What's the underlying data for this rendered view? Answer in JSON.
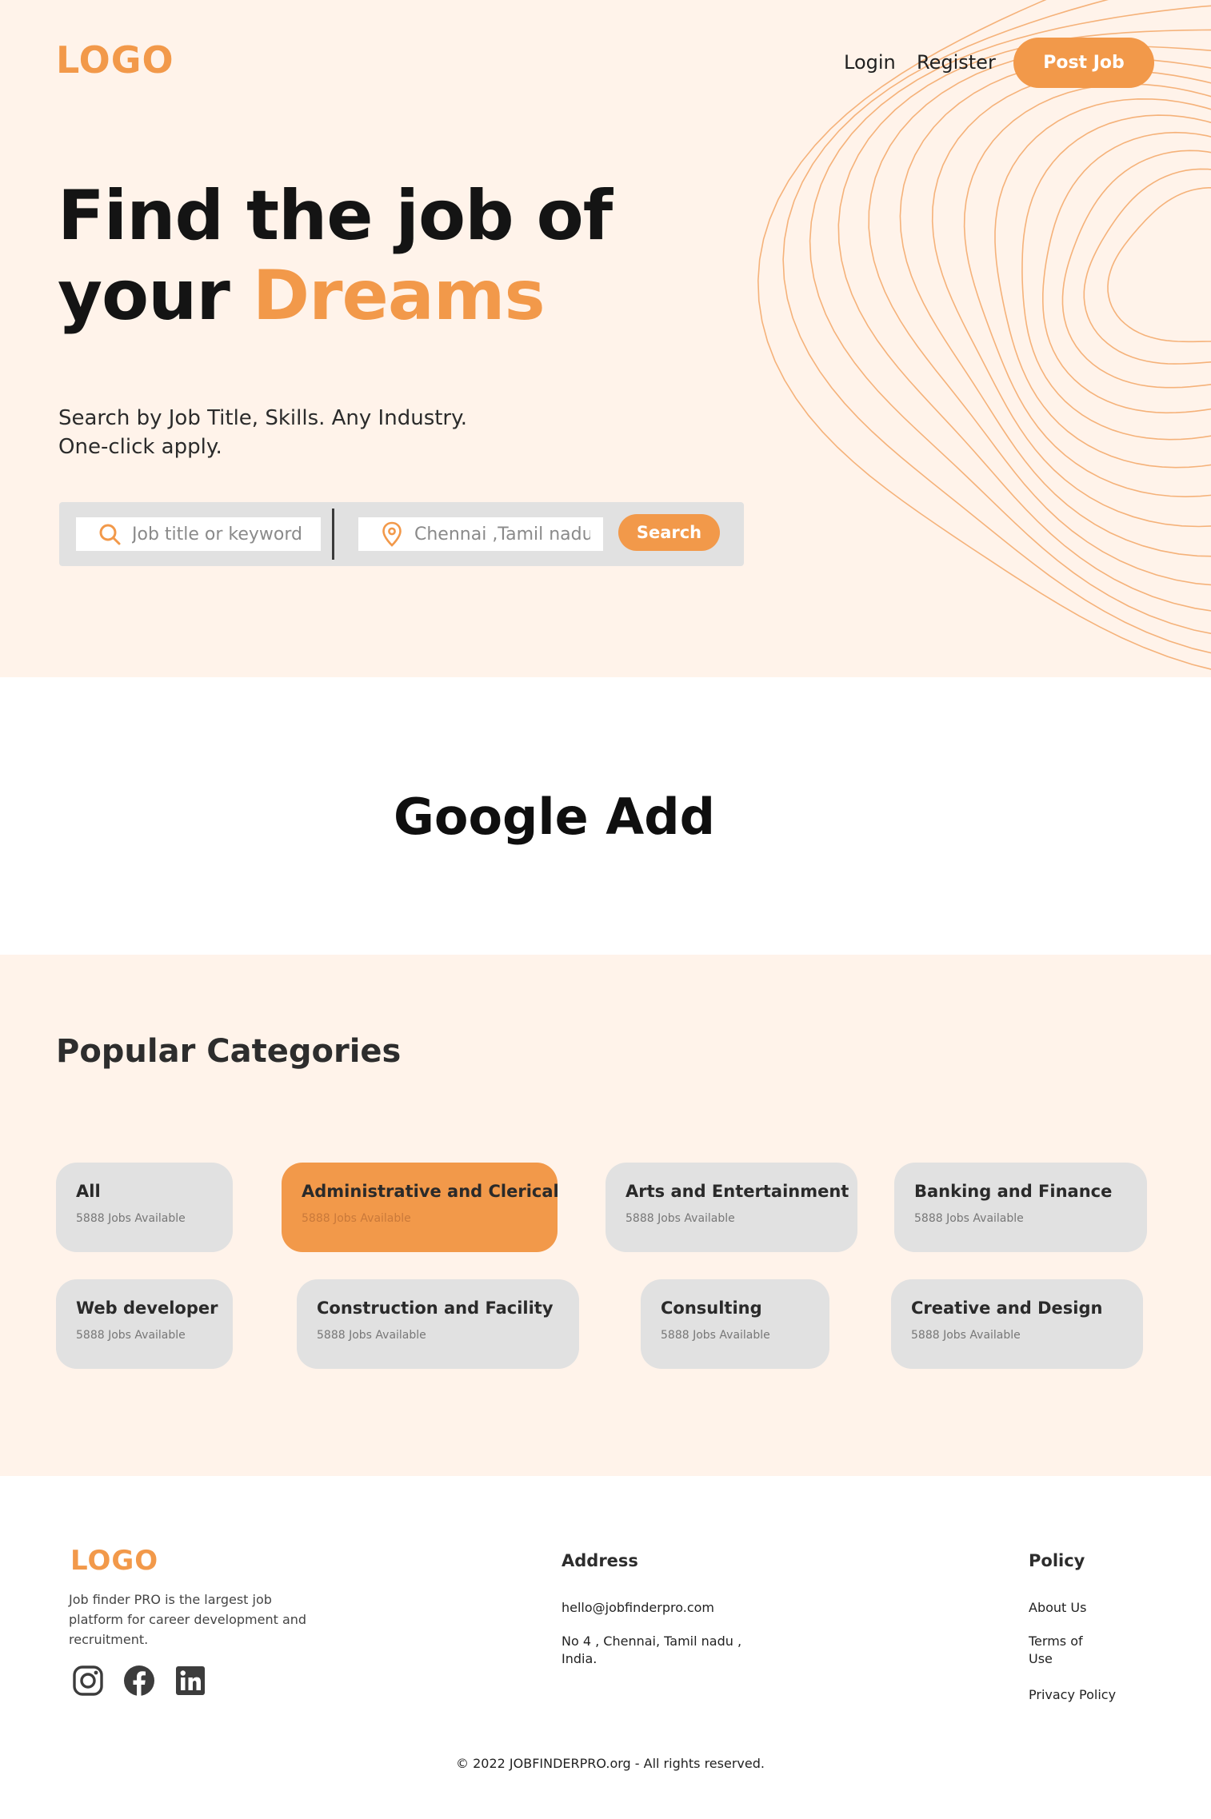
{
  "header": {
    "logo": "LOGO",
    "nav": {
      "login": "Login",
      "register": "Register"
    },
    "post_job": "Post Job"
  },
  "hero": {
    "headline_line1": "Find the job of",
    "headline_line2_prefix": "your ",
    "headline_line2_accent": "Dreams",
    "subline_1": "Search by Job Title, Skills. Any Industry.",
    "subline_2": "One-click apply."
  },
  "search": {
    "job_placeholder": "Job title or keyword",
    "location_placeholder": "Chennai ,Tamil nadu",
    "button": "Search"
  },
  "ad": {
    "text": "Google Add"
  },
  "categories": {
    "title": "Popular Categories",
    "items": [
      {
        "name": "All",
        "count": "5888 Jobs Available",
        "active": false
      },
      {
        "name": "Administrative and Clerical",
        "count": "5888 Jobs Available",
        "active": true
      },
      {
        "name": "Arts and Entertainment",
        "count": "5888 Jobs Available",
        "active": false
      },
      {
        "name": "Banking and Finance",
        "count": "5888 Jobs Available",
        "active": false
      },
      {
        "name": "Web developer",
        "count": "5888 Jobs Available",
        "active": false
      },
      {
        "name": "Construction and Facility",
        "count": "5888 Jobs Available",
        "active": false
      },
      {
        "name": "Consulting",
        "count": "5888 Jobs Available",
        "active": false
      },
      {
        "name": "Creative and Design",
        "count": "5888 Jobs Available",
        "active": false
      }
    ]
  },
  "footer": {
    "logo": "LOGO",
    "description": "Job finder PRO is the largest job platform for career development and recruitment.",
    "socials": [
      "instagram-icon",
      "facebook-icon",
      "linkedin-icon"
    ],
    "address_heading": "Address",
    "email": "hello@jobfinderpro.com",
    "address_line1": "No 4 , Chennai, Tamil nadu ,",
    "address_line2": "India.",
    "policy_heading": "Policy",
    "about": "About Us",
    "terms_line1": "Terms of",
    "terms_line2": "Use",
    "privacy": "Privacy Policy",
    "copyright": "© 2022 JOBFINDERPRO.org - All rights reserved."
  },
  "colors": {
    "accent": "#f2994a",
    "hero_bg": "#fff3ea",
    "card_bg": "#e1e1e1"
  }
}
